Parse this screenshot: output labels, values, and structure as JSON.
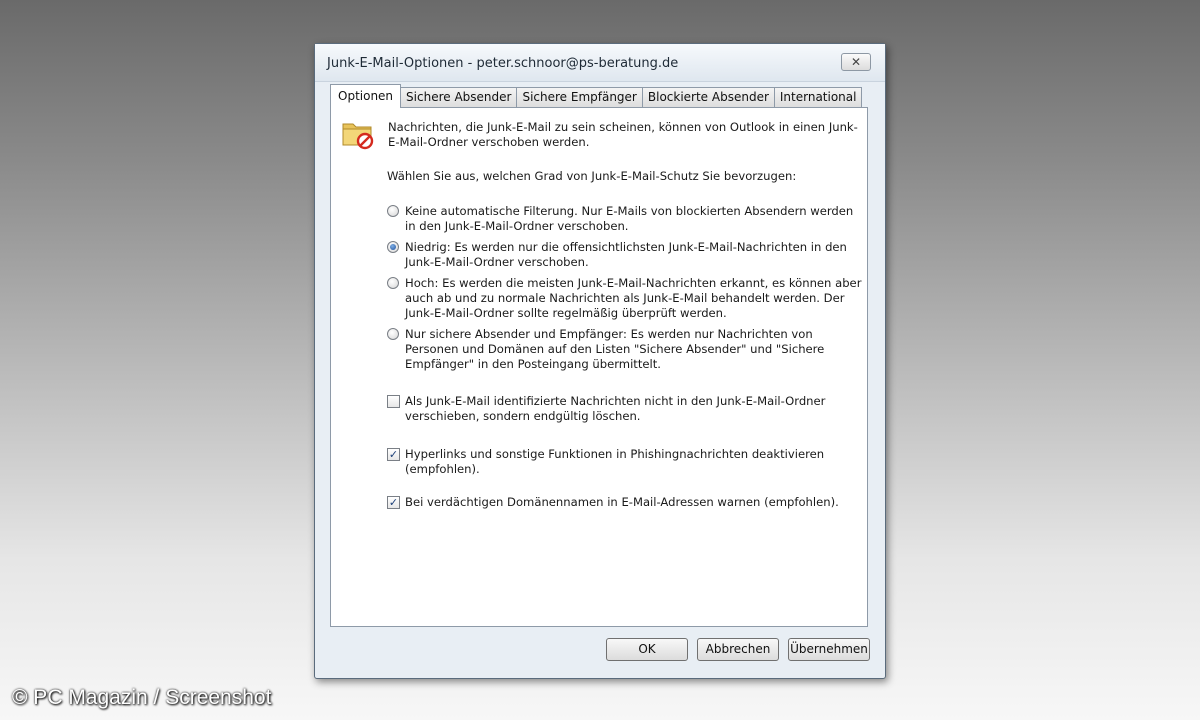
{
  "window": {
    "title": "Junk-E-Mail-Optionen - peter.schnoor@ps-beratung.de",
    "close_glyph": "✕"
  },
  "tabs": [
    {
      "label": "Optionen",
      "active": true
    },
    {
      "label": "Sichere Absender",
      "active": false
    },
    {
      "label": "Sichere Empfänger",
      "active": false
    },
    {
      "label": "Blockierte Absender",
      "active": false
    },
    {
      "label": "International",
      "active": false
    }
  ],
  "panel": {
    "icon": "junk-folder-icon",
    "intro": "Nachrichten, die Junk-E-Mail zu sein scheinen, können von Outlook in einen Junk-E-Mail-Ordner verschoben werden.",
    "prompt": "Wählen Sie aus, welchen Grad von Junk-E-Mail-Schutz Sie bevorzugen:",
    "levels": [
      {
        "label": "Keine automatische Filterung. Nur E-Mails von blockierten Absendern werden in den Junk-E-Mail-Ordner verschoben.",
        "selected": false
      },
      {
        "label": "Niedrig: Es werden nur die offensichtlichsten Junk-E-Mail-Nachrichten in den Junk-E-Mail-Ordner verschoben.",
        "selected": true
      },
      {
        "label": "Hoch: Es werden die meisten Junk-E-Mail-Nachrichten erkannt, es können aber auch ab und zu normale Nachrichten als Junk-E-Mail behandelt werden. Der Junk-E-Mail-Ordner sollte regelmäßig überprüft werden.",
        "selected": false
      },
      {
        "label": "Nur sichere Absender und Empfänger: Es werden nur Nachrichten von Personen und Domänen auf den Listen \"Sichere Absender\" und \"Sichere Empfänger\" in den Posteingang übermittelt.",
        "selected": false
      }
    ],
    "checkboxes": [
      {
        "label": "Als Junk-E-Mail identifizierte Nachrichten nicht in den Junk-E-Mail-Ordner verschieben, sondern endgültig löschen.",
        "checked": false
      },
      {
        "label": "Hyperlinks und sonstige Funktionen in Phishingnachrichten deaktivieren (empfohlen).",
        "checked": true
      },
      {
        "label": "Bei verdächtigen Domänennamen in E-Mail-Adressen warnen (empfohlen).",
        "checked": true
      }
    ],
    "check_glyph": "✓"
  },
  "buttons": {
    "ok": "OK",
    "cancel": "Abbrechen",
    "apply": "Übernehmen"
  },
  "caption": "© PC Magazin / Screenshot"
}
